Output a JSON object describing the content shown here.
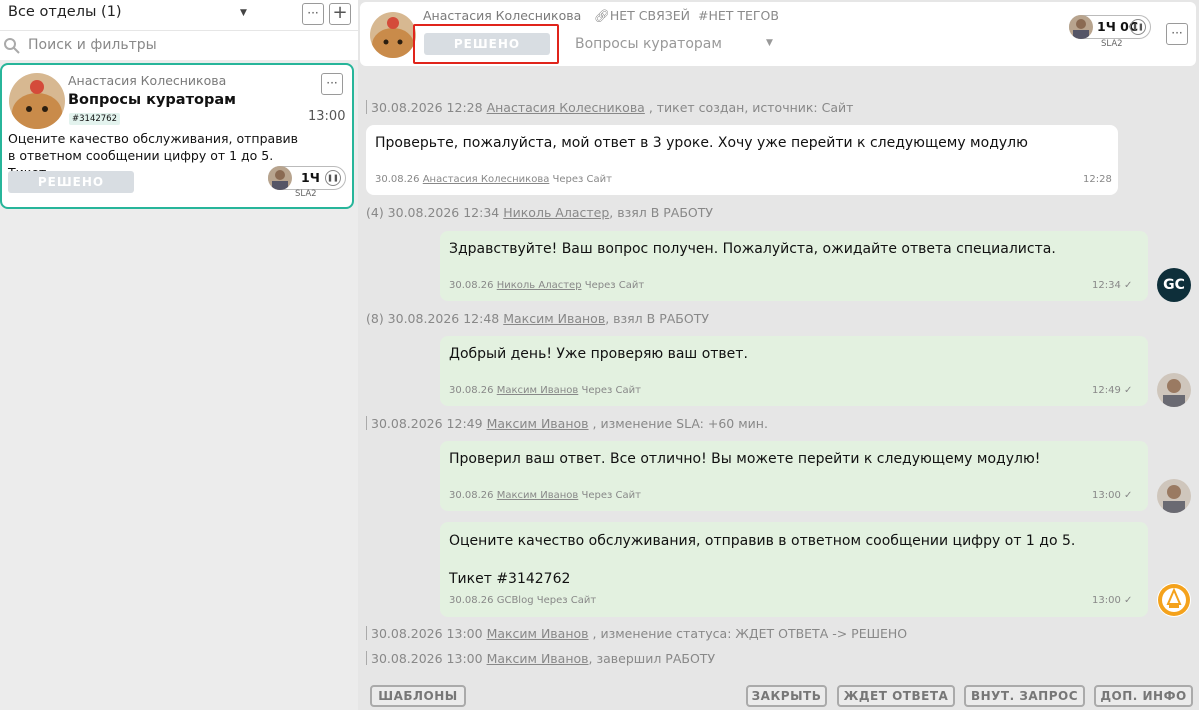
{
  "left": {
    "department": "Все отделы (1)",
    "search_placeholder": "Поиск и фильтры",
    "more_label": "···",
    "add_label": "+",
    "ticket": {
      "name": "Анастасия Колесникова",
      "subject": "Вопросы кураторам",
      "id": "#3142762",
      "time": "13:00",
      "preview": "Оцените качество обслуживания, отправив в ответном сообщении цифру от 1 до 5. Тикет...",
      "status": "РЕШЕНО",
      "sla_value": "1Ч",
      "sla_label": "SLA2"
    }
  },
  "header": {
    "name": "Анастасия Колесникова",
    "links": "НЕТ СВЯЗЕЙ",
    "tags": "#НЕТ ТЕГОВ",
    "status": "РЕШЕНО",
    "category": "Вопросы кураторам",
    "sla_value": "1Ч 0С",
    "sla_label": "SLA2"
  },
  "events": [
    {
      "date": "30.08.2026 12:28",
      "user": "Анастасия Колесникова",
      "rest": " , тикет создан, источник: Сайт"
    },
    {
      "date": "(4) 30.08.2026 12:34",
      "user": "Николь Аластер",
      "rest": ", взял В РАБОТУ"
    },
    {
      "date": "(8) 30.08.2026 12:48",
      "user": "Максим Иванов",
      "rest": ", взял В РАБОТУ"
    },
    {
      "date": "30.08.2026 12:49",
      "user": "Максим Иванов",
      "rest": " , изменение SLA: +60 мин."
    },
    {
      "date": "30.08.2026 13:00",
      "user": "Максим Иванов",
      "rest": " , изменение статуса: ЖДЕТ ОТВЕТА -> РЕШЕНО"
    },
    {
      "date": "30.08.2026 13:00",
      "user": "Максим Иванов",
      "rest": ", завершил РАБОТУ"
    }
  ],
  "messages": [
    {
      "text": "Проверьте, пожалуйста, мой ответ в 3 уроке. Хочу уже перейти к следующему модулю",
      "date": "30.08.26",
      "author": "Анастасия Колесникова",
      "via": " Через Сайт",
      "time": "12:28"
    },
    {
      "text": "Здравствуйте! Ваш вопрос получен. Пожалуйста, ожидайте ответа специалиста.",
      "date": "30.08.26",
      "author": "Николь Аластер",
      "via": " Через Сайт",
      "time": "12:34 ✓"
    },
    {
      "text": "Добрый день! Уже проверяю ваш ответ.",
      "date": "30.08.26",
      "author": "Максим Иванов",
      "via": " Через Сайт",
      "time": "12:49 ✓"
    },
    {
      "text": "Проверил ваш ответ. Все отлично! Вы можете перейти к следующему модулю!",
      "date": "30.08.26",
      "author": "Максим Иванов",
      "via": " Через Сайт",
      "time": "13:00 ✓"
    },
    {
      "text": "Оцените качество обслуживания, отправив в ответном сообщении цифру от 1 до 5.\n\nТикет #3142762",
      "date": "30.08.26",
      "author": "GCBlog",
      "via": " Через Сайт",
      "time": "13:00 ✓"
    }
  ],
  "avatars": {
    "gc": "GC"
  },
  "buttons": {
    "templates": "ШАБЛОНЫ",
    "close": "ЗАКРЫТЬ",
    "waiting": "ЖДЕТ ОТВЕТА",
    "internal": "ВНУТ. ЗАПРОС",
    "info": "ДОП. ИНФО"
  },
  "colors": {
    "accent": "#27b59a",
    "status_bg": "#d8dde2",
    "highlight": "#e0241b",
    "agent_bubble": "#e3f1e0"
  }
}
